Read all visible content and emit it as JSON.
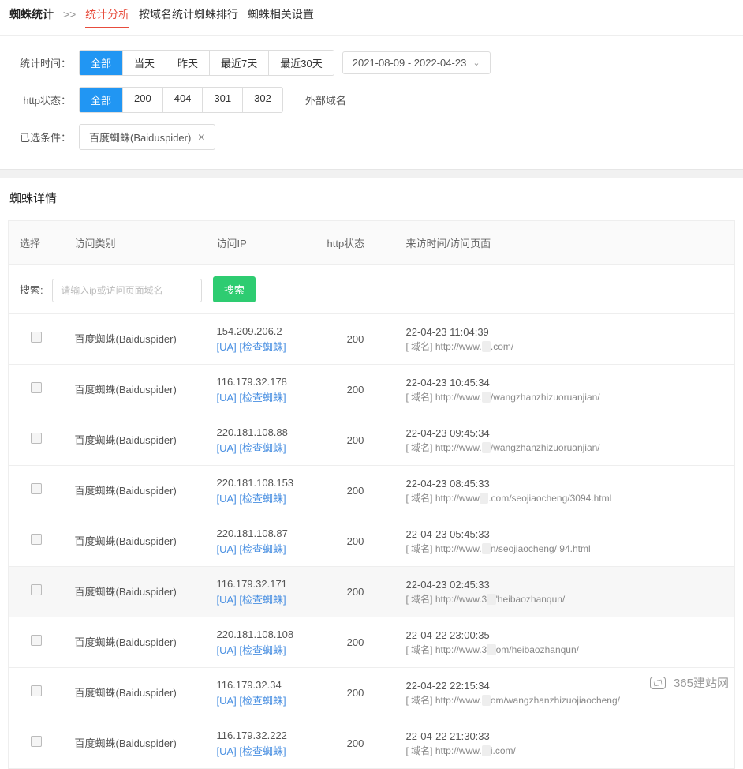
{
  "breadcrumb": {
    "title": "蜘蛛统计",
    "sep": ">>",
    "active": "统计分析",
    "link1": "按域名统计蜘蛛排行",
    "link2": "蜘蛛相关设置"
  },
  "filters": {
    "time_label": "统计时间：",
    "time_options": [
      "全部",
      "当天",
      "昨天",
      "最近7天",
      "最近30天"
    ],
    "time_active_index": 0,
    "date_range": "2021-08-09 - 2022-04-23",
    "status_label": "http状态：",
    "status_options": [
      "全部",
      "200",
      "404",
      "301",
      "302"
    ],
    "status_active_index": 0,
    "ext_domain": "外部域名",
    "selected_label": "已选条件：",
    "selected_tag": "百度蜘蛛(Baiduspider)"
  },
  "section_title": "蜘蛛详情",
  "table": {
    "headers": {
      "select": "选择",
      "type": "访问类别",
      "ip": "访问IP",
      "status": "http状态",
      "visit": "来访时间/访问页面"
    },
    "search": {
      "label": "搜索:",
      "placeholder": "请输入ip或访问页面域名",
      "btn": "搜索"
    },
    "ua_label": "[UA]",
    "check_label": "[检查蜘蛛]",
    "domain_tag": "[ 域名]",
    "rows": [
      {
        "type": "百度蜘蛛(Baiduspider)",
        "ip": "154.209.206.2",
        "status": "200",
        "time": "22-04-23 11:04:39",
        "url_pre": "http://www.",
        "url_blur": "             ",
        "url_post": ".com/",
        "highlight": false
      },
      {
        "type": "百度蜘蛛(Baiduspider)",
        "ip": "116.179.32.178",
        "status": "200",
        "time": "22-04-23 10:45:34",
        "url_pre": "http://www.",
        "url_blur": "             ",
        "url_post": "/wangzhanzhizuoruanjian/",
        "highlight": false
      },
      {
        "type": "百度蜘蛛(Baiduspider)",
        "ip": "220.181.108.88",
        "status": "200",
        "time": "22-04-23 09:45:34",
        "url_pre": "http://www.",
        "url_blur": "             ",
        "url_post": "/wangzhanzhizuoruanjian/",
        "highlight": false
      },
      {
        "type": "百度蜘蛛(Baiduspider)",
        "ip": "220.181.108.153",
        "status": "200",
        "time": "22-04-23 08:45:33",
        "url_pre": "http://www",
        "url_blur": "            ",
        "url_post": ".com/seojiaocheng/3094.html",
        "highlight": false
      },
      {
        "type": "百度蜘蛛(Baiduspider)",
        "ip": "220.181.108.87",
        "status": "200",
        "time": "22-04-23 05:45:33",
        "url_pre": "http://www.",
        "url_blur": "            ",
        "url_post": "n/seojiaocheng/   94.html",
        "highlight": false
      },
      {
        "type": "百度蜘蛛(Baiduspider)",
        "ip": "116.179.32.171",
        "status": "200",
        "time": "22-04-23 02:45:33",
        "url_pre": "http://www.3",
        "url_blur": "            ",
        "url_post": "'heibaozhanqun/",
        "highlight": true
      },
      {
        "type": "百度蜘蛛(Baiduspider)",
        "ip": "220.181.108.108",
        "status": "200",
        "time": "22-04-22 23:00:35",
        "url_pre": "http://www.3",
        "url_blur": "          ",
        "url_post": "om/heibaozhanqun/",
        "highlight": false
      },
      {
        "type": "百度蜘蛛(Baiduspider)",
        "ip": "116.179.32.34",
        "status": "200",
        "time": "22-04-22 22:15:34",
        "url_pre": "http://www.",
        "url_blur": "           ",
        "url_post": "om/wangzhanzhizuojiaocheng/",
        "highlight": false
      },
      {
        "type": "百度蜘蛛(Baiduspider)",
        "ip": "116.179.32.222",
        "status": "200",
        "time": "22-04-22 21:30:33",
        "url_pre": "http://www.",
        "url_blur": "          ",
        "url_post": "i.com/",
        "highlight": false
      }
    ]
  },
  "watermark": "365建站网"
}
